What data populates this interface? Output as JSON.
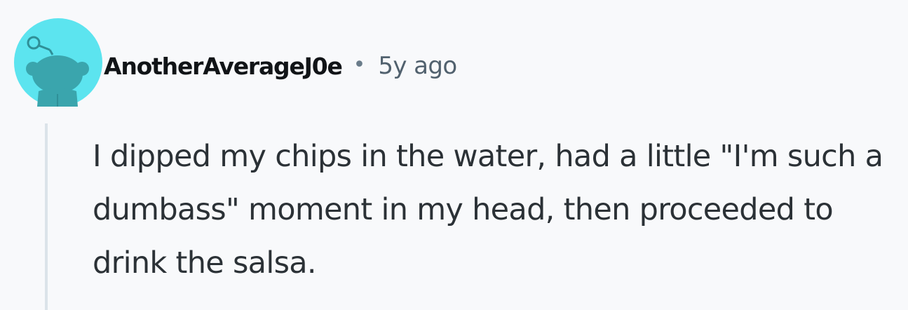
{
  "comment": {
    "author": "AnotherAverageJ0e",
    "separator": "•",
    "timestamp": "5y ago",
    "body": "I dipped my chips in the water, had a little \"I'm such a dumbass\" moment in my head, then proceeded to drink the salsa.",
    "avatar_icon": "snoo-avatar-icon",
    "colors": {
      "avatar_background": "#5ce4ef",
      "avatar_figure": "#3aa5ad",
      "username": "#111417",
      "timestamp": "#51616e",
      "body_text": "#2b3136",
      "thread_line": "#dbe3e9",
      "page_background": "#f8f9fb"
    }
  }
}
